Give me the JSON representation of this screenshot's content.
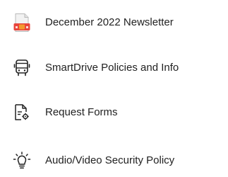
{
  "nav": {
    "items": [
      {
        "label": "December 2022 Newsletter",
        "icon": "newsletter-document-icon"
      },
      {
        "label": "SmartDrive Policies and Info",
        "icon": "bus-icon"
      },
      {
        "label": "Request Forms",
        "icon": "form-settings-icon"
      },
      {
        "label": "Audio/Video Security Policy",
        "icon": "lightbulb-icon"
      }
    ]
  },
  "colors": {
    "text": "#222222",
    "icon_stroke": "#222222",
    "accent_red": "#e8453c",
    "accent_orange": "#f39a2e",
    "icon_fill_light": "#f2f2f2"
  }
}
